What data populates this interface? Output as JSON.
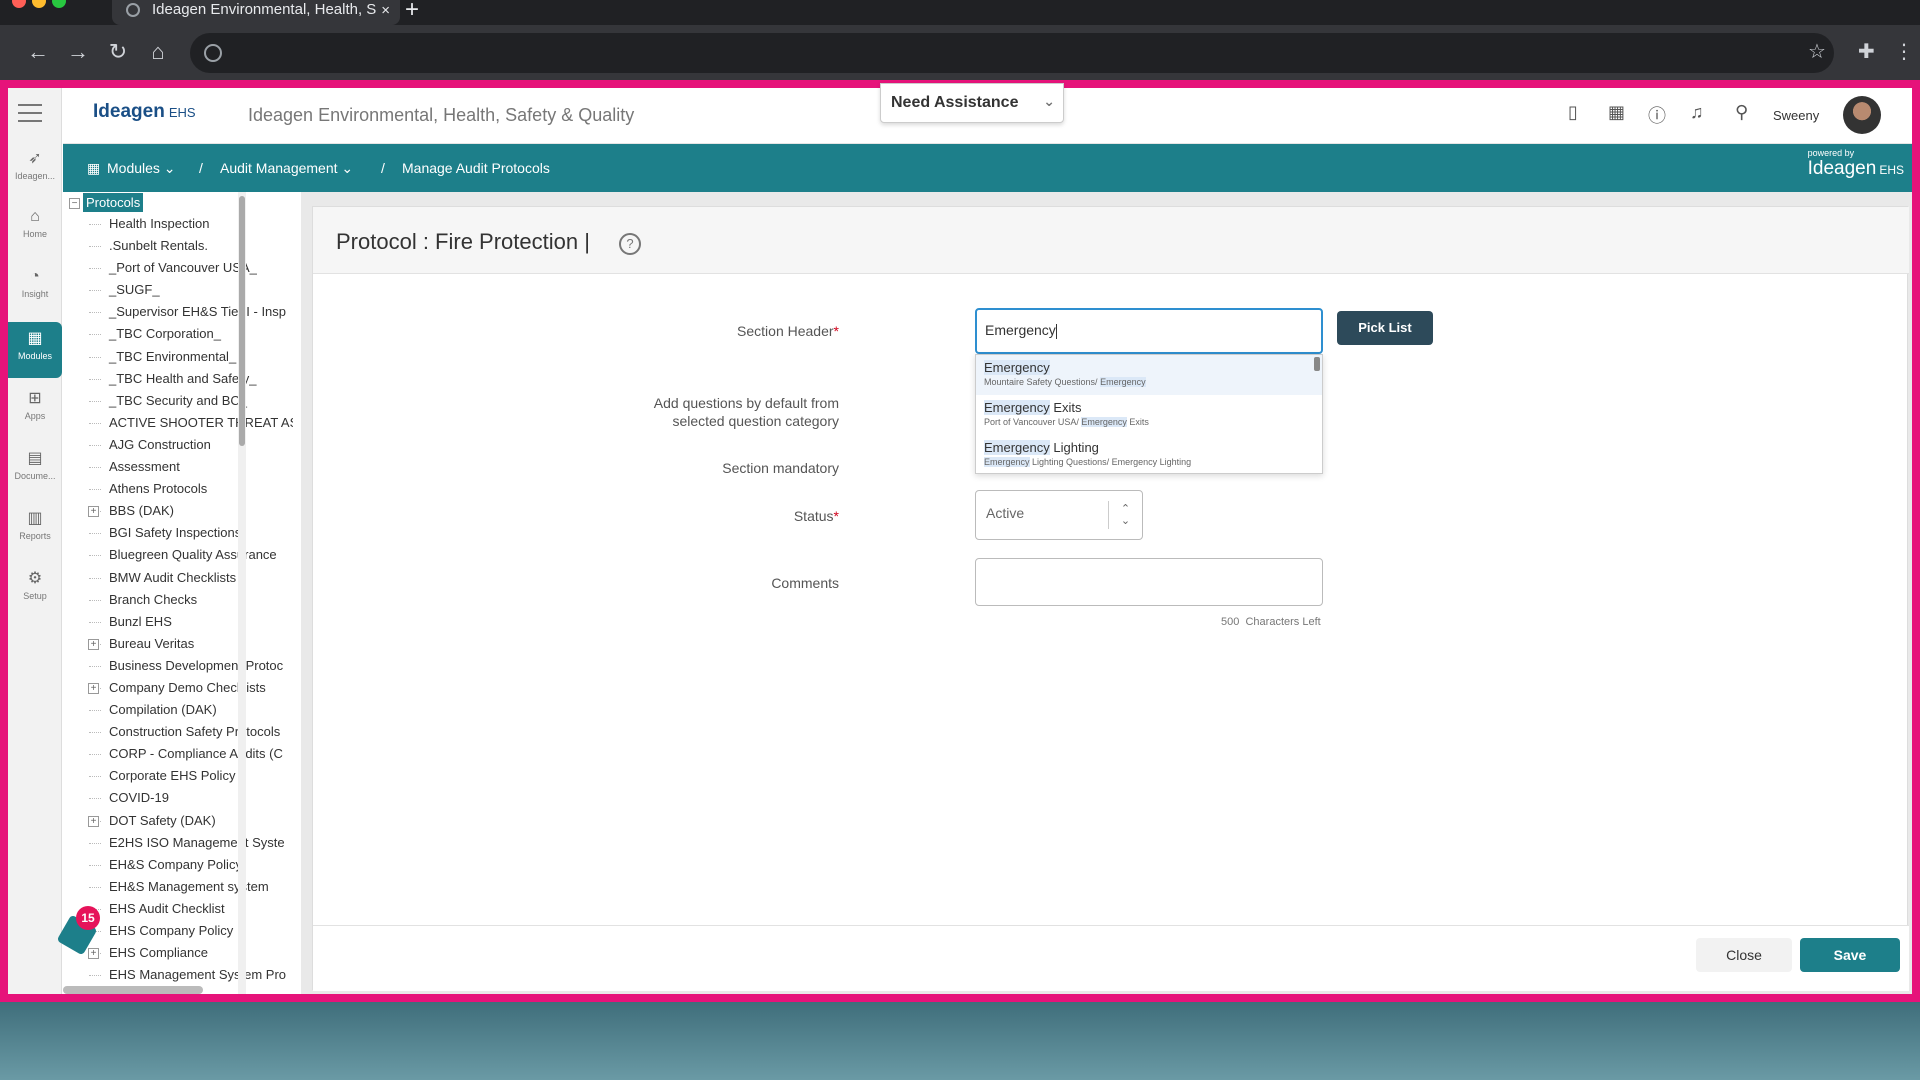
{
  "browser": {
    "tab_title": "Ideagen Environmental, Health, S",
    "tab_close": "×",
    "new_tab": "+"
  },
  "header": {
    "logo": "Ideagen",
    "logo_suffix": "EHS",
    "app_title": "Ideagen Environmental, Health, Safety & Quality",
    "assistance": "Need Assistance",
    "username": "Sweeny"
  },
  "rail": {
    "items": [
      {
        "label": "Ideagen...",
        "icon": "ideagen-icon"
      },
      {
        "label": "Home",
        "icon": "home-icon"
      },
      {
        "label": "Insight",
        "icon": "insight-icon"
      },
      {
        "label": "Modules",
        "icon": "modules-icon"
      },
      {
        "label": "Apps",
        "icon": "apps-icon"
      },
      {
        "label": "Docume...",
        "icon": "document-icon"
      },
      {
        "label": "Reports",
        "icon": "reports-icon"
      },
      {
        "label": "Setup",
        "icon": "setup-icon"
      }
    ]
  },
  "breadcrumb": {
    "modules": "Modules",
    "audit": "Audit Management",
    "current": "Manage Audit Protocols",
    "sep": "/",
    "powered_small": "powered by",
    "powered_big": "Ideagen",
    "powered_suffix": "EHS"
  },
  "tree": {
    "root": "Protocols",
    "items": [
      {
        "label": "Health Inspection",
        "expandable": false
      },
      {
        "label": ".Sunbelt Rentals.",
        "expandable": false
      },
      {
        "label": "_Port of Vancouver USA_",
        "expandable": false
      },
      {
        "label": "_SUGF_",
        "expandable": false
      },
      {
        "label": "_Supervisor EH&S Tier I - Insp",
        "expandable": false
      },
      {
        "label": "_TBC Corporation_",
        "expandable": false
      },
      {
        "label": "_TBC Environmental_",
        "expandable": false
      },
      {
        "label": "_TBC Health and Safety_",
        "expandable": false
      },
      {
        "label": "_TBC Security and BC_",
        "expandable": false
      },
      {
        "label": "ACTIVE SHOOTER THREAT AS",
        "expandable": false
      },
      {
        "label": "AJG Construction",
        "expandable": false
      },
      {
        "label": "Assessment",
        "expandable": false
      },
      {
        "label": "Athens Protocols",
        "expandable": false
      },
      {
        "label": "BBS (DAK)",
        "expandable": true
      },
      {
        "label": "BGI Safety Inspections",
        "expandable": false
      },
      {
        "label": "Bluegreen Quality Assurance",
        "expandable": false
      },
      {
        "label": "BMW Audit Checklists",
        "expandable": false
      },
      {
        "label": "Branch Checks",
        "expandable": false
      },
      {
        "label": "Bunzl EHS",
        "expandable": false
      },
      {
        "label": "Bureau Veritas",
        "expandable": true
      },
      {
        "label": "Business Development Protoc",
        "expandable": false
      },
      {
        "label": "Company Demo Checklists",
        "expandable": true
      },
      {
        "label": "Compilation (DAK)",
        "expandable": false
      },
      {
        "label": "Construction Safety Protocols",
        "expandable": false
      },
      {
        "label": "CORP - Compliance Audits (C",
        "expandable": false
      },
      {
        "label": "Corporate EHS Policy",
        "expandable": false
      },
      {
        "label": "COVID-19",
        "expandable": false
      },
      {
        "label": "DOT Safety (DAK)",
        "expandable": true
      },
      {
        "label": "E2HS ISO Management Syste",
        "expandable": false
      },
      {
        "label": "EH&S Company Policy",
        "expandable": false
      },
      {
        "label": "EH&S Management system",
        "expandable": false
      },
      {
        "label": "EHS Audit Checklist",
        "expandable": false
      },
      {
        "label": "EHS Company Policy",
        "expandable": false
      },
      {
        "label": "EHS Compliance",
        "expandable": true
      },
      {
        "label": "EHS Management System Pro",
        "expandable": false
      }
    ]
  },
  "notifications_badge": "15",
  "form": {
    "title": "Protocol : Fire Protection |",
    "help": "?",
    "section_header_label": "Section Header",
    "required_mark": "*",
    "section_header_value": "Emergency",
    "pick_list": "Pick List",
    "add_questions_label_1": "Add questions by default from",
    "add_questions_label_2": "selected question category",
    "section_mandatory_label": "Section mandatory",
    "status_label": "Status",
    "status_value": "Active",
    "comments_label": "Comments",
    "chars_left_count": "500",
    "chars_left_text": "Characters Left",
    "close": "Close",
    "save": "Save"
  },
  "suggestions": [
    {
      "t1": "Emergency",
      "t2": "",
      "s1": "Mountaire Safety Questions/ ",
      "s2": "Emergency",
      "s3": ""
    },
    {
      "t1": "Emergency",
      "t2": " Exits",
      "s1": "Port of Vancouver USA/ ",
      "s2": "Emergency",
      "s3": " Exits"
    },
    {
      "t1": "Emergency",
      "t2": " Lighting",
      "s1": "",
      "s2": "Emergency",
      "s3": " Lighting Questions/ Emergency Lighting"
    }
  ],
  "colors": {
    "accent": "#1d7f8a",
    "frame": "#e6137a",
    "focus": "#2e8fd0"
  }
}
